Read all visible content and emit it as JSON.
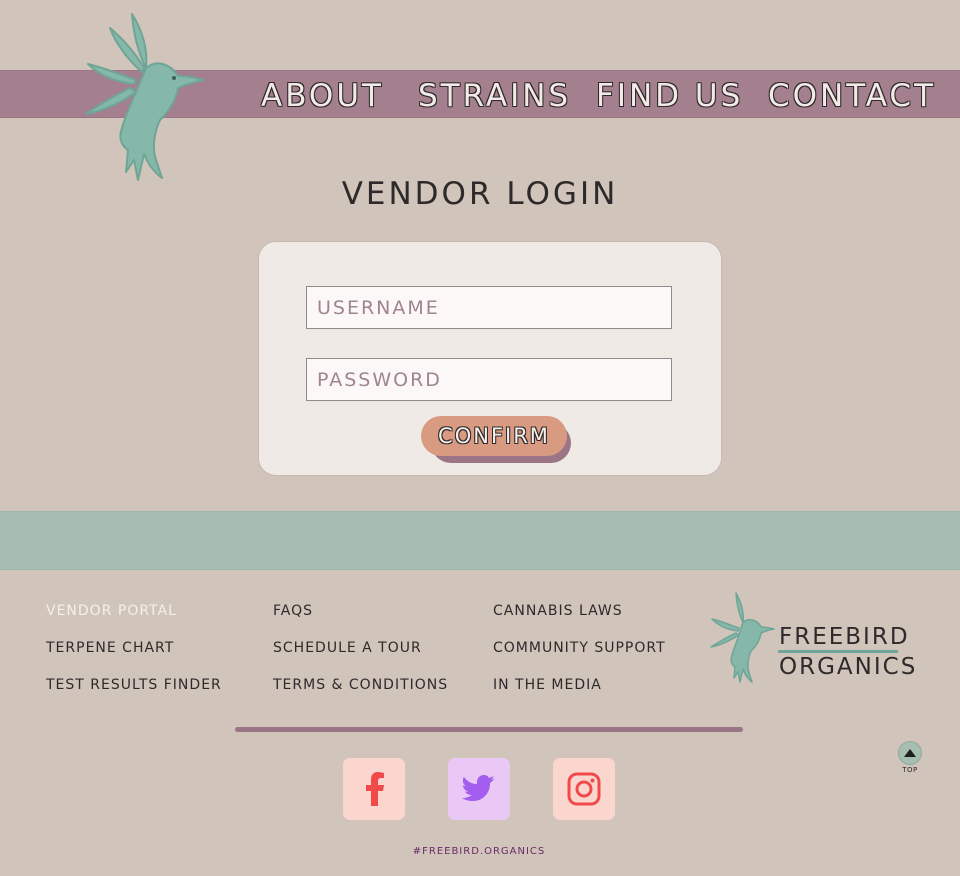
{
  "nav": {
    "about": "About",
    "strains": "Strains",
    "find_us": "Find Us",
    "contact": "Contact"
  },
  "page_title": "Vendor Login",
  "login": {
    "username_placeholder": "Username",
    "password_placeholder": "Password",
    "confirm_label": "Confirm"
  },
  "footer": {
    "col1": [
      "Vendor Portal",
      "Terpene Chart",
      "Test Results Finder"
    ],
    "col2": [
      "FAQs",
      "Schedule a Tour",
      "Terms & Conditions"
    ],
    "col3": [
      "Cannabis Laws",
      "Community Support",
      "In the Media"
    ],
    "brand_line1": "Freebird",
    "brand_line2": "Organics",
    "hashtag": "#freebird.organics",
    "top_label": "TOP"
  },
  "social": {
    "facebook_icon": "facebook-icon",
    "twitter_icon": "twitter-icon",
    "instagram_icon": "instagram-icon"
  },
  "colors": {
    "background": "#d1c4bb",
    "nav_band": "#a4808e",
    "teal": "#a6bdb1",
    "bird": "#7cb1a3",
    "confirm": "#d99a82"
  }
}
